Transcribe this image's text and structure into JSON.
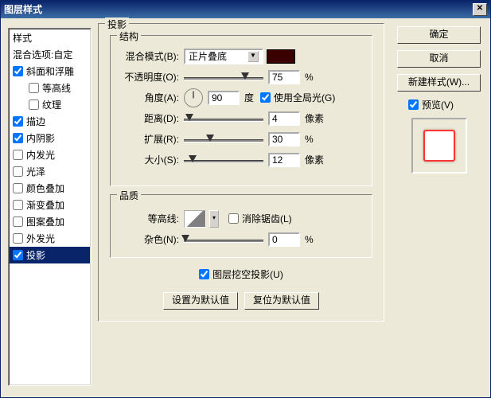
{
  "title": "图层样式",
  "sidebar": {
    "header": "样式",
    "blendOpt": "混合选项:自定",
    "items": [
      {
        "label": "斜面和浮雕",
        "checked": true,
        "indent": 0
      },
      {
        "label": "等高线",
        "checked": false,
        "indent": 1
      },
      {
        "label": "纹理",
        "checked": false,
        "indent": 1
      },
      {
        "label": "描边",
        "checked": true,
        "indent": 0
      },
      {
        "label": "内阴影",
        "checked": true,
        "indent": 0
      },
      {
        "label": "内发光",
        "checked": false,
        "indent": 0
      },
      {
        "label": "光泽",
        "checked": false,
        "indent": 0
      },
      {
        "label": "颜色叠加",
        "checked": false,
        "indent": 0
      },
      {
        "label": "渐变叠加",
        "checked": false,
        "indent": 0
      },
      {
        "label": "图案叠加",
        "checked": false,
        "indent": 0
      },
      {
        "label": "外发光",
        "checked": false,
        "indent": 0
      },
      {
        "label": "投影",
        "checked": true,
        "indent": 0,
        "selected": true
      }
    ]
  },
  "main": {
    "panelTitle": "投影",
    "structTitle": "结构",
    "qualityTitle": "品质",
    "labels": {
      "blendMode": "混合模式(B):",
      "opacity": "不透明度(O):",
      "angle": "角度(A):",
      "angleUnit": "度",
      "useGlobal": "使用全局光(G)",
      "distance": "距离(D):",
      "spread": "扩展(R):",
      "size": "大小(S):",
      "contour": "等高线:",
      "antialias": "消除锯齿(L)",
      "noise": "杂色(N):",
      "knockout": "图层挖空投影(U)",
      "px": "像素",
      "pct": "%"
    },
    "values": {
      "blendMode": "正片叠底",
      "opacity": "75",
      "angle": "90",
      "useGlobal": true,
      "distance": "4",
      "spread": "30",
      "size": "12",
      "antialias": false,
      "noise": "0",
      "knockout": true
    },
    "buttons": {
      "setDefault": "设置为默认值",
      "resetDefault": "复位为默认值"
    },
    "color": "#3a0000"
  },
  "right": {
    "ok": "确定",
    "cancel": "取消",
    "newStyle": "新建样式(W)...",
    "preview": "预览(V)",
    "previewChecked": true
  }
}
